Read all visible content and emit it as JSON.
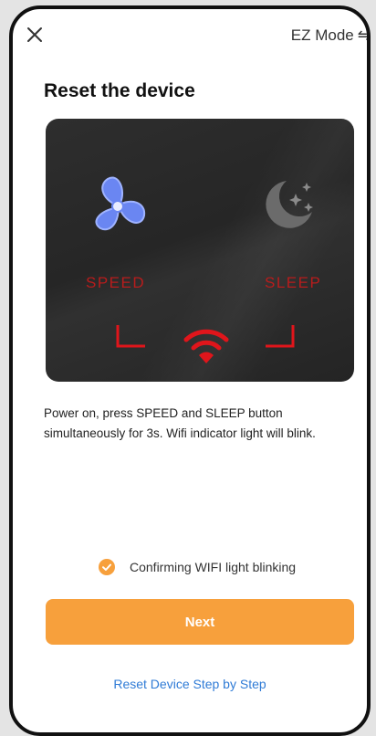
{
  "header": {
    "mode_label": "EZ Mode",
    "mode_icon": "swap-arrows-icon"
  },
  "page": {
    "title": "Reset the device"
  },
  "illustration": {
    "speed_label": "SPEED",
    "sleep_label": "SLEEP",
    "icons": [
      "fan-icon",
      "moon-stars-icon",
      "wifi-icon"
    ]
  },
  "instruction": "Power on, press SPEED and SLEEP button simultaneously for 3s. Wifi indicator light will blink.",
  "confirm": {
    "label": "Confirming WIFI light blinking",
    "checked": true
  },
  "actions": {
    "next_label": "Next",
    "step_link_label": "Reset Device Step by Step"
  },
  "colors": {
    "accent": "#f7a03c",
    "link": "#2f7bd6",
    "indicator_red": "#e0151b",
    "fan_blue": "#6a86f2"
  }
}
